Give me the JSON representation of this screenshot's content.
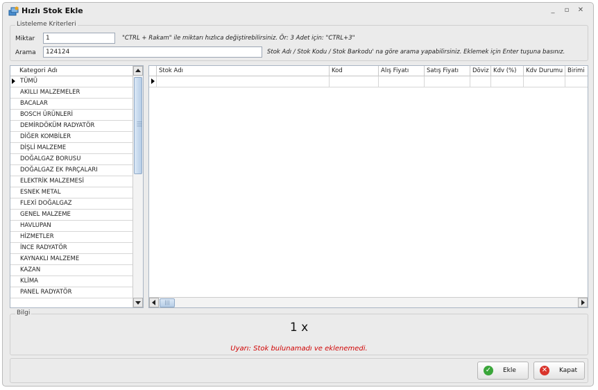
{
  "window": {
    "title": "Hızlı Stok Ekle"
  },
  "criteria": {
    "legend": "Listeleme Kriterleri",
    "quantity_label": "Miktar",
    "quantity_value": "1",
    "quantity_hint": "\"CTRL + Rakam\" ile miktarı hızlıca değiştirebilirsiniz. Ör: 3 Adet için: \"CTRL+3\"",
    "search_label": "Arama",
    "search_value": "124124",
    "search_hint": "Stok Adı / Stok Kodu / Stok Barkodu' na göre arama yapabilirsiniz. Eklemek için Enter tuşuna basınız."
  },
  "categories": {
    "header": "Kategori Adı",
    "items": [
      "TÜMÜ",
      "AKILLI MALZEMELER",
      "BACALAR",
      "BOSCH ÜRÜNLERİ",
      "DEMİRDÖKÜM RADYATÖR",
      "DİĞER KOMBİLER",
      "DİŞLİ MALZEME",
      "DOĞALGAZ BORUSU",
      "DOĞALGAZ EK PARÇALARI",
      "ELEKTRİK MALZEMESİ",
      "ESNEK METAL",
      "FLEXİ DOĞALGAZ",
      "GENEL MALZEME",
      "HAVLUPAN",
      "HİZMETLER",
      "İNCE RADYATÖR",
      "KAYNAKLI MALZEME",
      "KAZAN",
      "KLİMA",
      "PANEL RADYATÖR"
    ],
    "selected_index": 0
  },
  "stock_grid": {
    "columns": [
      "Stok Adı",
      "Kod",
      "Alış Fiyatı",
      "Satış Fiyatı",
      "Döviz",
      "Kdv (%)",
      "Kdv Durumu",
      "Birimi"
    ]
  },
  "info": {
    "legend": "Bilgi",
    "quantity_display": "1 x",
    "warning": "Uyarı: Stok bulunamadı ve eklenemedi."
  },
  "buttons": {
    "add_label": "Ekle",
    "close_label": "Kapat"
  },
  "colors": {
    "warning": "#d00000",
    "add_icon": "#3aa63a",
    "close_icon": "#d9342b"
  }
}
